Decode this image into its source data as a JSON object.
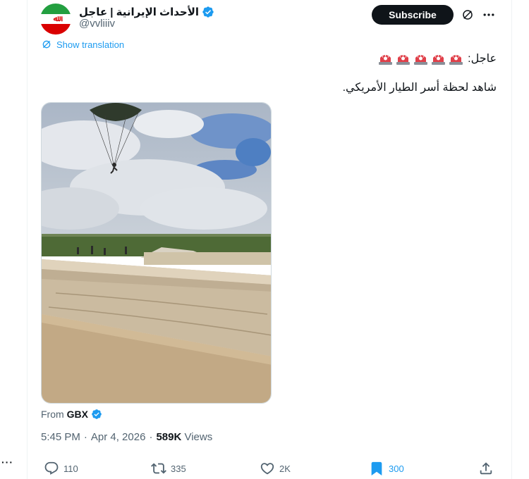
{
  "author": {
    "display_name": "الأحداث الإيرانية | عاجل",
    "handle": "@vvliiiv"
  },
  "header": {
    "subscribe_label": "Subscribe"
  },
  "translation": {
    "label": "Show translation"
  },
  "tweet": {
    "line1_text": "عاجل:",
    "line1_emoji": "🚨",
    "line1_emoji_count": 5,
    "line2_text": "شاهد لحظة أسر الطيار الأمريكي."
  },
  "media": {
    "from_prefix": "From",
    "from_source": "GBX"
  },
  "meta": {
    "time": "5:45 PM",
    "separator": "·",
    "date": "Apr 4, 2026",
    "views_count": "589K",
    "views_label": "Views"
  },
  "actions": {
    "replies": "110",
    "reposts": "335",
    "likes": "2K",
    "bookmarks": "300"
  },
  "colors": {
    "accent": "#1d9bf0",
    "text": "#0f1419",
    "muted": "#536471"
  }
}
